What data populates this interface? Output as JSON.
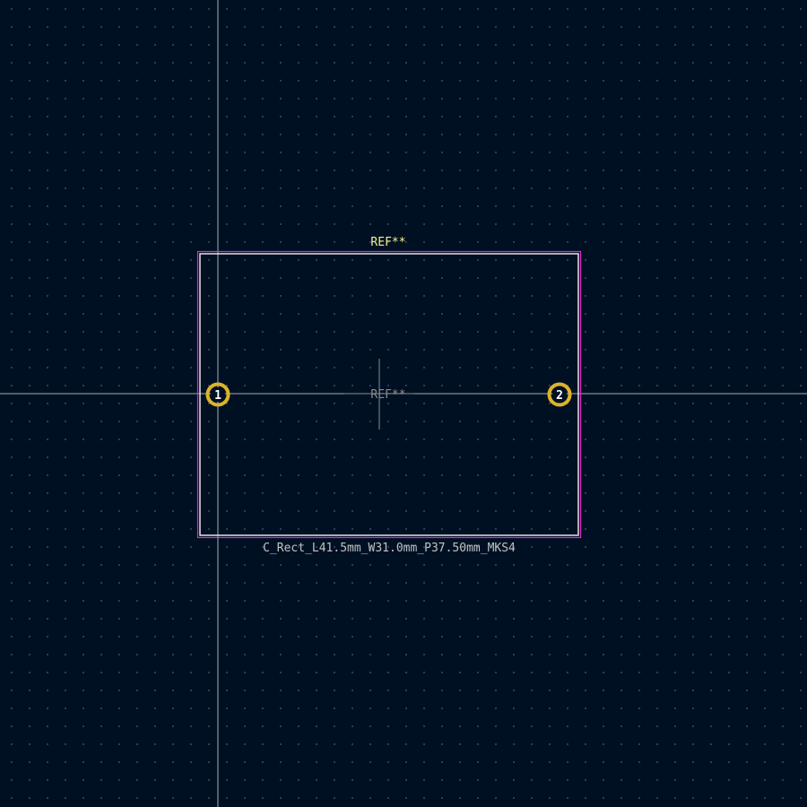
{
  "footprint": {
    "reference_top": "REF**",
    "reference_center": "REF**",
    "value": "C_Rect_L41.5mm_W31.0mm_P37.50mm_MKS4",
    "pads": [
      {
        "number": "1"
      },
      {
        "number": "2"
      }
    ]
  },
  "colors": {
    "background": "#001023",
    "grid_dot": "#3a4a5e",
    "crosshair": "#c8c8c8",
    "courtyard": "#ff26e2",
    "silkscreen": "#f2f2f2",
    "pad_ring": "#dcb42a",
    "reference_text": "#f2f28c",
    "value_text": "#c2c2c2"
  }
}
